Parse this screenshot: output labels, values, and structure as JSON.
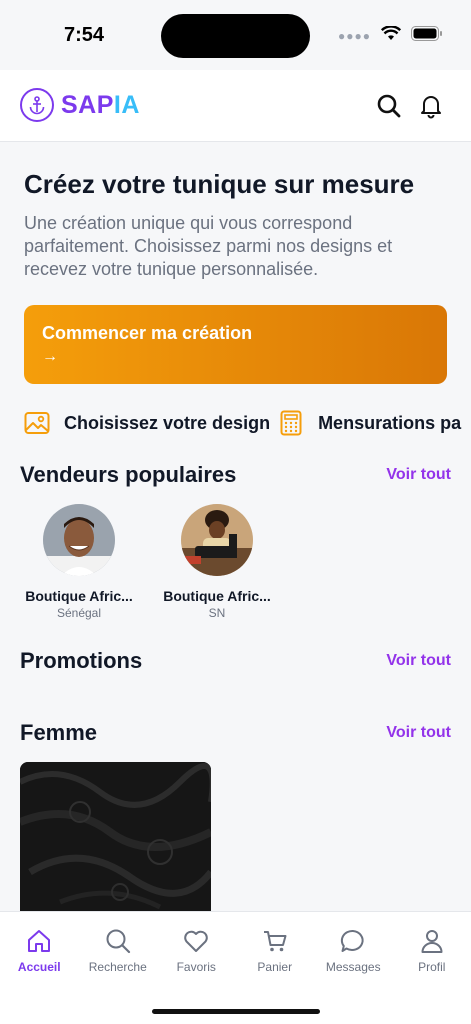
{
  "status_bar": {
    "time": "7:54"
  },
  "header": {
    "logo_part1": "SAP",
    "logo_part2": "IA",
    "search_icon": "search-icon",
    "bell_icon": "bell-icon"
  },
  "hero": {
    "title": "Créez votre tunique sur mesure",
    "subtitle": "Une création unique qui vous correspond parfaitement. Choisissez parmi nos designs et recevez votre tunique personnalisée.",
    "cta_label": "Commencer ma création",
    "cta_arrow": "→"
  },
  "features": [
    {
      "icon": "image-icon",
      "label": "Choisissez votre design"
    },
    {
      "icon": "calculator-icon",
      "label": "Mensurations pa"
    }
  ],
  "vendors_section": {
    "title": "Vendeurs populaires",
    "see_all": "Voir tout",
    "items": [
      {
        "name": "Boutique Afric...",
        "country": "Sénégal"
      },
      {
        "name": "Boutique Afric...",
        "country": "SN"
      }
    ]
  },
  "promotions_section": {
    "title": "Promotions",
    "see_all": "Voir tout"
  },
  "femme_section": {
    "title": "Femme",
    "see_all": "Voir tout"
  },
  "tab_bar": {
    "items": [
      {
        "label": "Accueil",
        "icon": "home-icon",
        "active": true
      },
      {
        "label": "Recherche",
        "icon": "search-icon"
      },
      {
        "label": "Favoris",
        "icon": "heart-icon"
      },
      {
        "label": "Panier",
        "icon": "cart-icon"
      },
      {
        "label": "Messages",
        "icon": "chat-icon"
      },
      {
        "label": "Profil",
        "icon": "user-icon"
      }
    ]
  },
  "colors": {
    "accent": "#7c3aed",
    "cta_start": "#f59e0b",
    "cta_end": "#d97706",
    "link": "#9333ea"
  }
}
